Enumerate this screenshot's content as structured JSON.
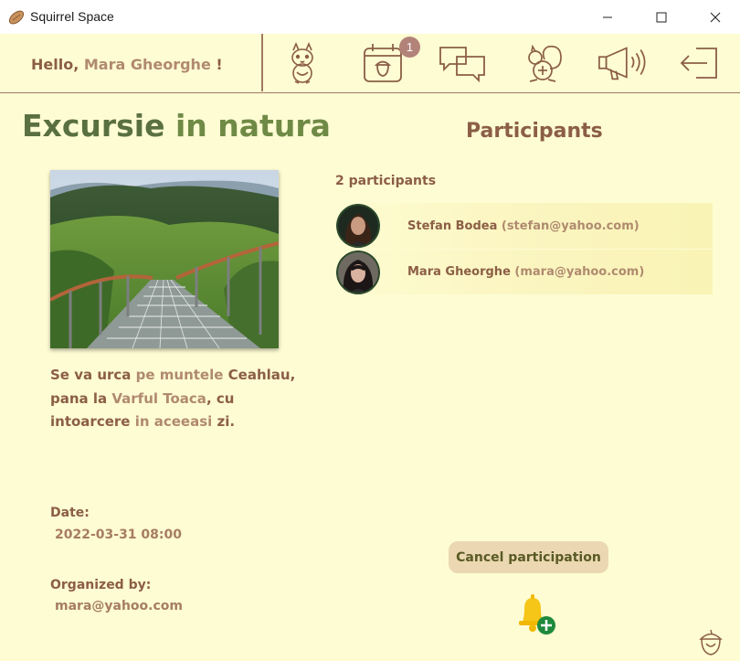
{
  "window": {
    "title": "Squirrel Space",
    "app_icon": "peanut-icon",
    "controls": [
      "minimize-icon",
      "maximize-icon",
      "close-icon"
    ]
  },
  "header": {
    "greeting_prefix": "Hello,",
    "user_name": "Mara Gheorghe",
    "greeting_suffix": "!",
    "nav_icons": [
      "squirrel-home-icon",
      "events-calendar-icon",
      "chat-icon",
      "add-squirrel-icon",
      "announcements-icon",
      "logout-icon"
    ],
    "events_badge": "1"
  },
  "event": {
    "title_part1": "Excursie",
    "title_part2": "in natura",
    "description": {
      "t1": "Se va urca ",
      "t2": "pe muntele",
      "t3": " Ceahlau, pana la ",
      "t4": "Varful Toaca",
      "t5": ", cu intoarcere ",
      "t6": "in",
      "t7": " ",
      "t8": "aceeasi",
      "t9": " zi."
    },
    "date_label": "Date:",
    "date_value": "2022-03-31 08:00",
    "organizer_label": "Organized by:",
    "organizer_value": "mara@yahoo.com"
  },
  "participants": {
    "heading": "Participants",
    "count_text": "2 participants",
    "items": [
      {
        "name": "Stefan Bodea",
        "email": "(stefan@yahoo.com)"
      },
      {
        "name": "Mara Gheorghe",
        "email": "(mara@yahoo.com)"
      }
    ]
  },
  "actions": {
    "cancel_label": "Cancel participation",
    "notify_icon": "bell-add-icon"
  },
  "colors": {
    "background": "#fefcd3",
    "brown_text": "#8b5e45",
    "green_title": "#5a7040",
    "button": "#ebd8b2",
    "badge": "#b3837a",
    "bell": "#f5c518"
  }
}
